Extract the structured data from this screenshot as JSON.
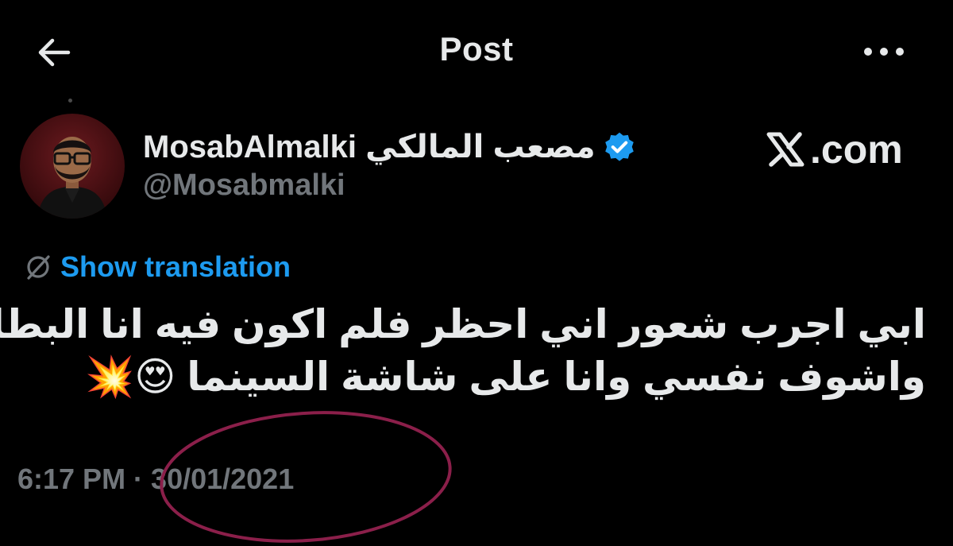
{
  "header": {
    "title": "Post",
    "back_icon": "arrow-left-icon",
    "more_icon": "more-horizontal-icon"
  },
  "author": {
    "display_name": "MosabAlmalki مصعب المالكي",
    "handle": "@Mosabmalki",
    "verified": true,
    "verified_color": "#1d9bf0"
  },
  "watermark": {
    "text": ".com",
    "logo": "x-logo-icon"
  },
  "translation": {
    "label": "Show translation",
    "icon": "globe-icon",
    "color": "#1d9bf0"
  },
  "tweet": {
    "lines": [
      "ابي اجرب شعور اني احظر فلم اكون فيه انا البطل",
      "واشوف نفسي وانا على شاشة السينما 😍💥"
    ]
  },
  "meta": {
    "timestamp": "6:17 PM · 30/01/2021",
    "annotation_color": "#8b1f4a"
  }
}
